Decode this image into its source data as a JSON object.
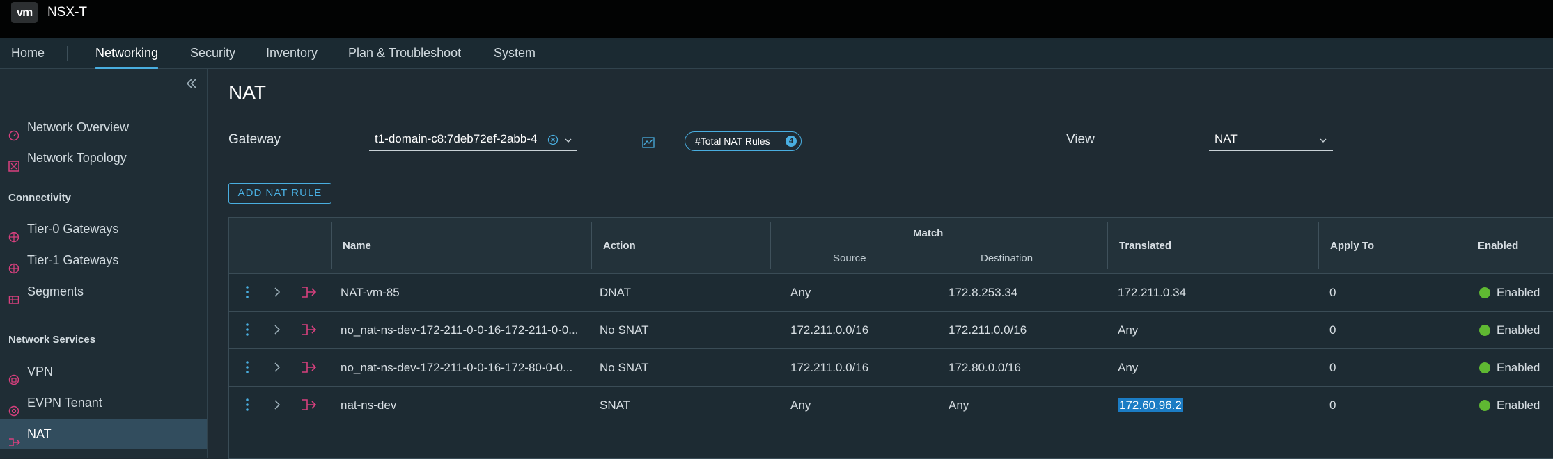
{
  "app": {
    "logo": "vm",
    "title": "NSX-T"
  },
  "nav": {
    "tabs": [
      "Home",
      "Networking",
      "Security",
      "Inventory",
      "Plan & Troubleshoot",
      "System"
    ],
    "active": "Networking"
  },
  "sidebar": {
    "collapse_icon": "double-chevron-left-icon",
    "items_top": [
      {
        "label": "Network Overview",
        "icon": "gauge-icon"
      },
      {
        "label": "Network Topology",
        "icon": "topology-icon"
      }
    ],
    "section_connectivity": "Connectivity",
    "items_connectivity": [
      {
        "label": "Tier-0 Gateways",
        "icon": "gateway-icon"
      },
      {
        "label": "Tier-1 Gateways",
        "icon": "gateway-icon"
      },
      {
        "label": "Segments",
        "icon": "segments-icon"
      }
    ],
    "section_services": "Network Services",
    "items_services": [
      {
        "label": "VPN",
        "icon": "vpn-icon"
      },
      {
        "label": "EVPN Tenant",
        "icon": "evpn-icon"
      },
      {
        "label": "NAT",
        "icon": "nat-icon",
        "active": true
      }
    ]
  },
  "page": {
    "title": "NAT",
    "gateway_label": "Gateway",
    "gateway_value": "t1-domain-c8:7deb72ef-2abb-4",
    "chip_label": "#Total NAT Rules",
    "chip_count": "4",
    "view_label": "View",
    "view_value": "NAT",
    "add_button": "ADD NAT RULE"
  },
  "table": {
    "headers": {
      "name": "Name",
      "action": "Action",
      "match": "Match",
      "source": "Source",
      "destination": "Destination",
      "translated": "Translated",
      "apply_to": "Apply To",
      "enabled": "Enabled"
    },
    "rows": [
      {
        "name": "NAT-vm-85",
        "action": "DNAT",
        "source": "Any",
        "destination": "172.8.253.34",
        "translated": "172.211.0.34",
        "apply_to": "0",
        "enabled": "Enabled"
      },
      {
        "name": "no_nat-ns-dev-172-211-0-0-16-172-211-0-0...",
        "action": "No SNAT",
        "source": "172.211.0.0/16",
        "destination": "172.211.0.0/16",
        "translated": "Any",
        "apply_to": "0",
        "enabled": "Enabled"
      },
      {
        "name": "no_nat-ns-dev-172-211-0-0-16-172-80-0-0...",
        "action": "No SNAT",
        "source": "172.211.0.0/16",
        "destination": "172.80.0.0/16",
        "translated": "Any",
        "apply_to": "0",
        "enabled": "Enabled"
      },
      {
        "name": "nat-ns-dev",
        "action": "SNAT",
        "source": "Any",
        "destination": "Any",
        "translated": "172.60.96.2",
        "apply_to": "0",
        "enabled": "Enabled",
        "translated_selected": true
      }
    ]
  },
  "colors": {
    "accent": "#49aee0",
    "nat_icon": "#d8407e",
    "enabled": "#5fb832",
    "selection": "#1b7cc4"
  }
}
